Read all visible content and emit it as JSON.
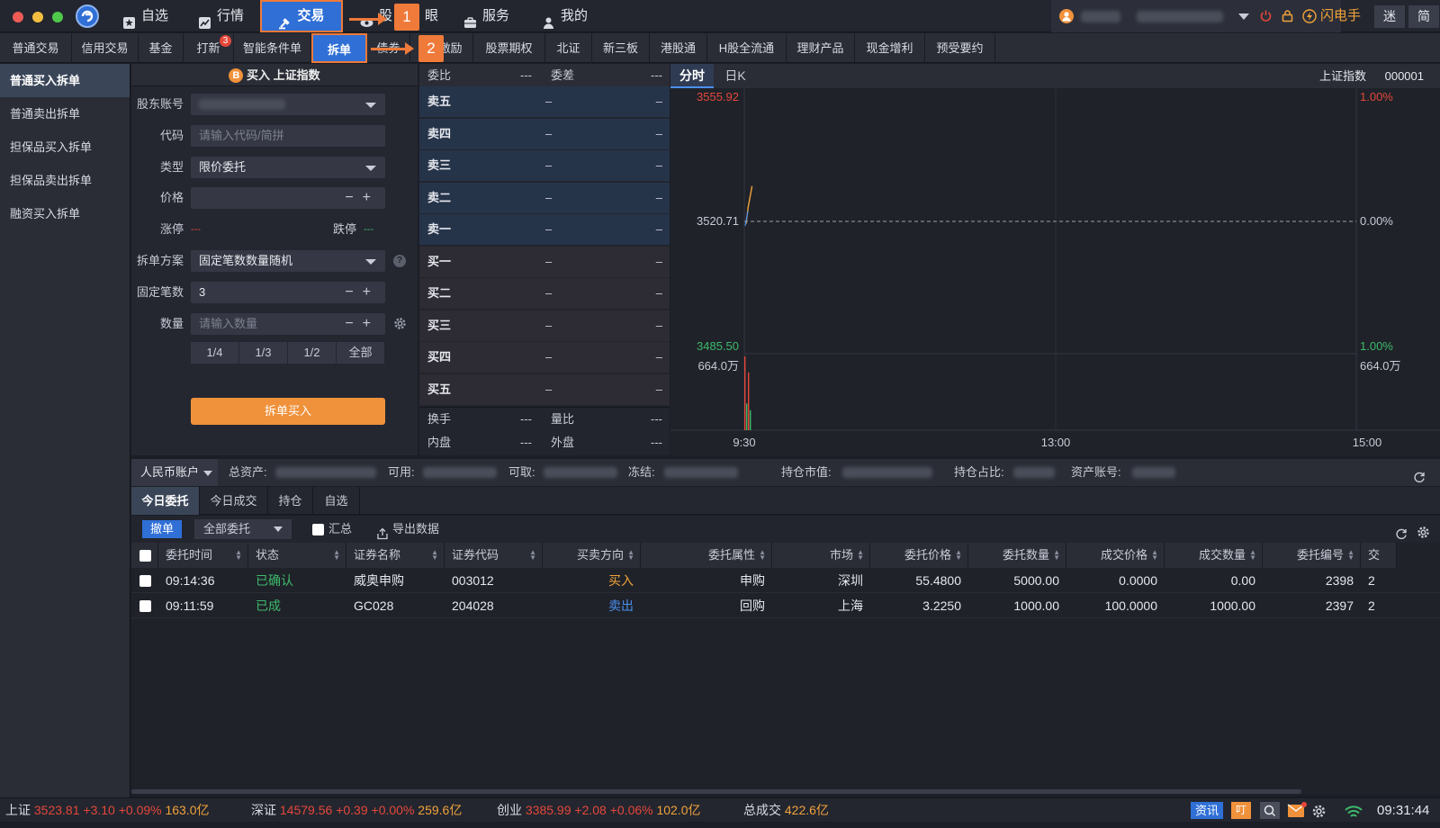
{
  "nav": {
    "items": [
      {
        "label": "自选",
        "icon": "star-icon"
      },
      {
        "label": "行情",
        "icon": "chart-icon"
      },
      {
        "label": "交易",
        "icon": "gavel-icon"
      },
      {
        "label": "股",
        "icon": "eye-icon"
      },
      {
        "label": "眼",
        "icon": ""
      },
      {
        "label": "服务",
        "icon": "briefcase-icon"
      },
      {
        "label": "我的",
        "icon": "person-icon"
      }
    ],
    "callout_1": "1",
    "callout_2": "2",
    "flash_label": "闪电手",
    "mini_label": "迷",
    "simple_label": "简"
  },
  "tabs2": [
    "普通交易",
    "信用交易",
    "基金",
    "打新",
    "智能条件单",
    "拆单",
    "债券",
    "激励",
    "股票期权",
    "北证",
    "新三板",
    "港股通",
    "H股全流通",
    "理财产品",
    "现金增利",
    "预受要约"
  ],
  "tabs2_badge": "3",
  "sidebar": [
    "普通买入拆单",
    "普通卖出拆单",
    "担保品买入拆单",
    "担保品卖出拆单",
    "融资买入拆单"
  ],
  "form": {
    "badge": "B",
    "title": "买入 上证指数",
    "account_label": "股东账号",
    "code_label": "代码",
    "code_placeholder": "请输入代码/简拼",
    "type_label": "类型",
    "type_value": "限价委托",
    "price_label": "价格",
    "limit_up_label": "涨停",
    "limit_up_value": "---",
    "limit_down_label": "跌停",
    "limit_down_value": "---",
    "plan_label": "拆单方案",
    "plan_value": "固定笔数数量随机",
    "count_label": "固定笔数",
    "count_value": "3",
    "qty_label": "数量",
    "qty_placeholder": "请输入数量",
    "fractions": [
      "1/4",
      "1/3",
      "1/2",
      "全部"
    ],
    "submit": "拆单买入"
  },
  "quote": {
    "weibi_label": "委比",
    "weibi_value": "---",
    "weicha_label": "委差",
    "weicha_value": "---",
    "rows": [
      {
        "label": "卖五",
        "v1": "–",
        "v2": "–",
        "side": "sell"
      },
      {
        "label": "卖四",
        "v1": "–",
        "v2": "–",
        "side": "sell"
      },
      {
        "label": "卖三",
        "v1": "–",
        "v2": "–",
        "side": "sell"
      },
      {
        "label": "卖二",
        "v1": "–",
        "v2": "–",
        "side": "sell"
      },
      {
        "label": "卖一",
        "v1": "–",
        "v2": "–",
        "side": "sell"
      },
      {
        "label": "买一",
        "v1": "–",
        "v2": "–",
        "side": "buy"
      },
      {
        "label": "买二",
        "v1": "–",
        "v2": "–",
        "side": "buy"
      },
      {
        "label": "买三",
        "v1": "–",
        "v2": "–",
        "side": "buy"
      },
      {
        "label": "买四",
        "v1": "–",
        "v2": "–",
        "side": "buy"
      },
      {
        "label": "买五",
        "v1": "–",
        "v2": "–",
        "side": "buy"
      }
    ],
    "huanshou_label": "换手",
    "huanshou_value": "---",
    "liangbi_label": "量比",
    "liangbi_value": "---",
    "neipan_label": "内盘",
    "neipan_value": "---",
    "waipan_label": "外盘",
    "waipan_value": "---"
  },
  "chart_data": {
    "type": "line",
    "tabs": [
      "分时",
      "日K"
    ],
    "index_name": "上证指数",
    "index_code": "000001",
    "y_top_label": "3555.92",
    "y_mid_label": "3520.71",
    "y_bottom_label": "3485.50",
    "pct_top_label": "1.00%",
    "pct_mid_label": "0.00%",
    "pct_bottom_label": "1.00%",
    "vol_label_left": "664.0万",
    "vol_label_right": "664.0万",
    "x_ticks": [
      "9:30",
      "13:00",
      "15:00"
    ],
    "ylim": [
      3485.5,
      3555.92
    ],
    "price_points": [
      3519.5,
      3524.0,
      3527.0,
      3530.0
    ],
    "volume_bars": [
      664.0,
      240.0,
      520.0,
      180.0
    ],
    "colors": {
      "price_line": "#f0a23b",
      "avg_line": "#4b8ff0",
      "up": "#e5473a",
      "down": "#3dba6a"
    }
  },
  "account": {
    "currency": "人民币账户",
    "total_label": "总资产:",
    "avail_label": "可用:",
    "withdraw_label": "可取:",
    "frozen_label": "冻结:",
    "mktval_label": "持仓市值:",
    "ratio_label": "持仓占比:",
    "acctno_label": "资产账号:"
  },
  "bottom_tabs": [
    "今日委托",
    "今日成交",
    "持仓",
    "自选"
  ],
  "toolbar": {
    "cancel": "撤单",
    "filter": "全部委托",
    "summary": "汇总",
    "export": "导出数据"
  },
  "table": {
    "headers": [
      "委托时间",
      "状态",
      "证券名称",
      "证券代码",
      "买卖方向",
      "委托属性",
      "市场",
      "委托价格",
      "委托数量",
      "成交价格",
      "成交数量",
      "委托编号",
      "交"
    ],
    "rows": [
      [
        "09:14:36",
        "已确认",
        "威奥申购",
        "003012",
        "买入",
        "申购",
        "深圳",
        "55.4800",
        "5000.00",
        "0.0000",
        "0.00",
        "2398",
        "2"
      ],
      [
        "09:11:59",
        "已成",
        "GC028",
        "204028",
        "卖出",
        "回购",
        "上海",
        "3.2250",
        "1000.00",
        "100.0000",
        "1000.00",
        "2397",
        "2"
      ]
    ]
  },
  "status": {
    "sh_label": "上证",
    "sh_value": "3523.81",
    "sh_change": "+3.10",
    "sh_pct": "+0.09%",
    "sh_amt": "163.0亿",
    "sz_label": "深证",
    "sz_value": "14579.56",
    "sz_change": "+0.39",
    "sz_pct": "+0.00%",
    "sz_amt": "259.6亿",
    "cy_label": "创业",
    "cy_value": "3385.99",
    "cy_change": "+2.08",
    "cy_pct": "+0.06%",
    "cy_amt": "102.0亿",
    "total_label": "总成交",
    "total_amt": "422.6亿",
    "news_label": "资讯",
    "ding_label": "叮",
    "time": "09:31:44"
  }
}
